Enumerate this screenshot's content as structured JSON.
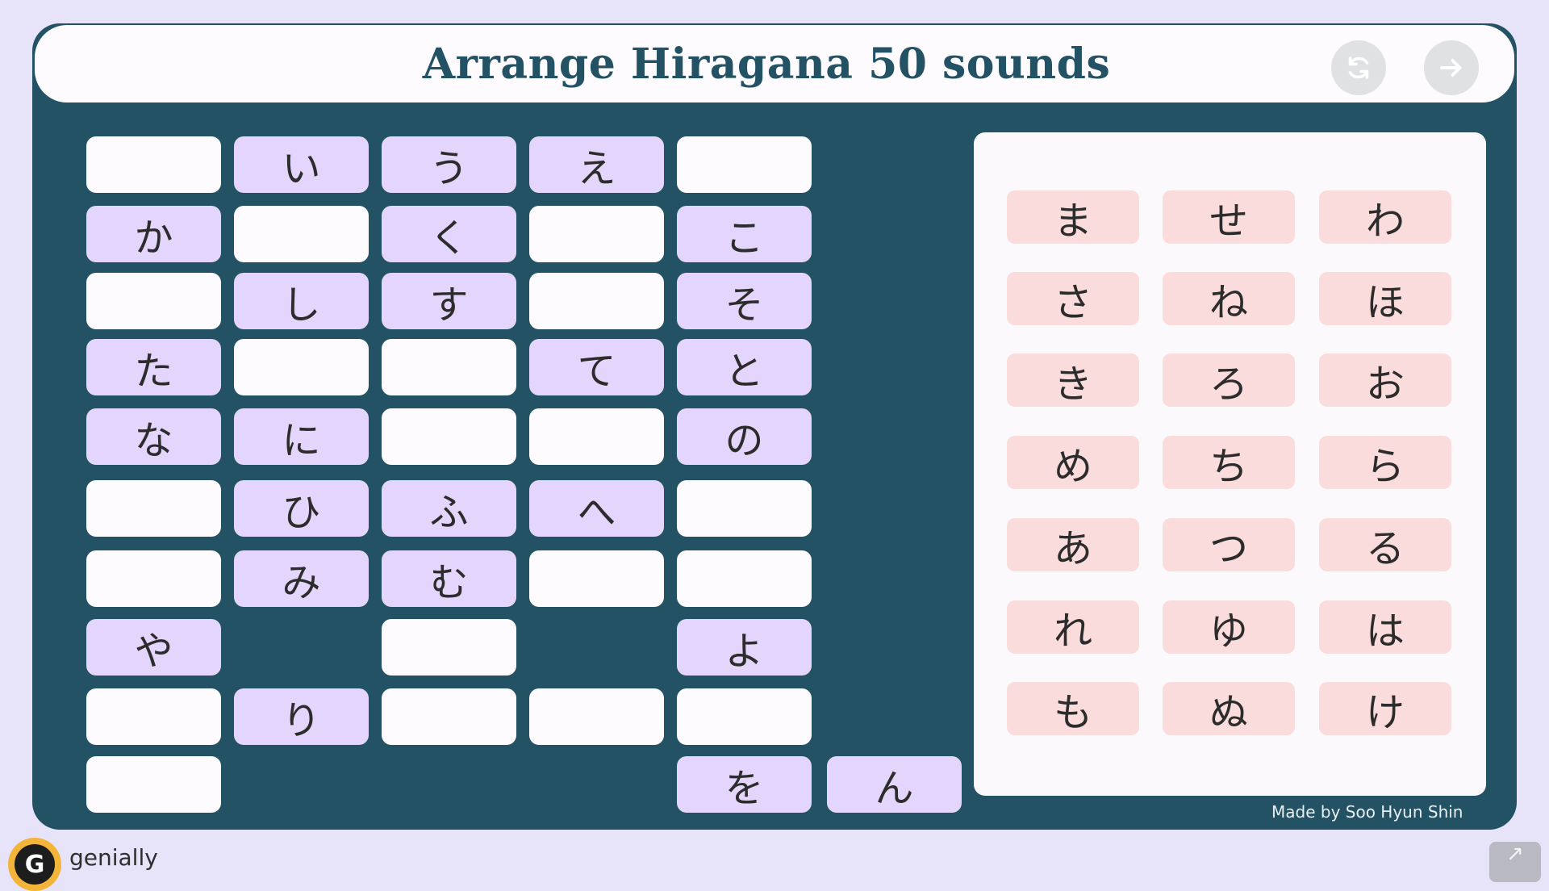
{
  "title": "Arrange Hiragana 50 sounds",
  "header": {
    "reset_icon": "refresh-icon",
    "next_icon": "arrow-right-icon"
  },
  "grid": {
    "slots": [
      {
        "col": 0,
        "row": 0,
        "char": ""
      },
      {
        "col": 1,
        "row": 0,
        "char": "い"
      },
      {
        "col": 2,
        "row": 0,
        "char": "う"
      },
      {
        "col": 3,
        "row": 0,
        "char": "え"
      },
      {
        "col": 4,
        "row": 0,
        "char": ""
      },
      {
        "col": 0,
        "row": 1,
        "char": "か"
      },
      {
        "col": 1,
        "row": 1,
        "char": ""
      },
      {
        "col": 2,
        "row": 1,
        "char": "く"
      },
      {
        "col": 3,
        "row": 1,
        "char": ""
      },
      {
        "col": 4,
        "row": 1,
        "char": "こ"
      },
      {
        "col": 0,
        "row": 2,
        "char": ""
      },
      {
        "col": 1,
        "row": 2,
        "char": "し"
      },
      {
        "col": 2,
        "row": 2,
        "char": "す"
      },
      {
        "col": 3,
        "row": 2,
        "char": ""
      },
      {
        "col": 4,
        "row": 2,
        "char": "そ"
      },
      {
        "col": 0,
        "row": 3,
        "char": "た"
      },
      {
        "col": 1,
        "row": 3,
        "char": ""
      },
      {
        "col": 2,
        "row": 3,
        "char": ""
      },
      {
        "col": 3,
        "row": 3,
        "char": "て"
      },
      {
        "col": 4,
        "row": 3,
        "char": "と"
      },
      {
        "col": 0,
        "row": 4,
        "char": "な"
      },
      {
        "col": 1,
        "row": 4,
        "char": "に"
      },
      {
        "col": 2,
        "row": 4,
        "char": ""
      },
      {
        "col": 3,
        "row": 4,
        "char": ""
      },
      {
        "col": 4,
        "row": 4,
        "char": "の"
      },
      {
        "col": 0,
        "row": 5,
        "char": ""
      },
      {
        "col": 1,
        "row": 5,
        "char": "ひ"
      },
      {
        "col": 2,
        "row": 5,
        "char": "ふ"
      },
      {
        "col": 3,
        "row": 5,
        "char": "へ"
      },
      {
        "col": 4,
        "row": 5,
        "char": ""
      },
      {
        "col": 0,
        "row": 6,
        "char": ""
      },
      {
        "col": 1,
        "row": 6,
        "char": "み"
      },
      {
        "col": 2,
        "row": 6,
        "char": "む"
      },
      {
        "col": 3,
        "row": 6,
        "char": ""
      },
      {
        "col": 4,
        "row": 6,
        "char": ""
      },
      {
        "col": 0,
        "row": 7,
        "char": "や"
      },
      {
        "col": 2,
        "row": 7,
        "char": ""
      },
      {
        "col": 4,
        "row": 7,
        "char": "よ"
      },
      {
        "col": 0,
        "row": 8,
        "char": ""
      },
      {
        "col": 1,
        "row": 8,
        "char": "り"
      },
      {
        "col": 2,
        "row": 8,
        "char": ""
      },
      {
        "col": 3,
        "row": 8,
        "char": ""
      },
      {
        "col": 4,
        "row": 8,
        "char": ""
      },
      {
        "col": 0,
        "row": 9,
        "char": ""
      },
      {
        "col": 4,
        "row": 9,
        "char": "を"
      },
      {
        "col": 5,
        "row": 9,
        "char": "ん"
      }
    ]
  },
  "pool": {
    "tiles": [
      [
        "ま",
        "せ",
        "わ"
      ],
      [
        "さ",
        "ね",
        "ほ"
      ],
      [
        "き",
        "ろ",
        "お"
      ],
      [
        "め",
        "ち",
        "ら"
      ],
      [
        "あ",
        "つ",
        "る"
      ],
      [
        "れ",
        "ゆ",
        "は"
      ],
      [
        "も",
        "ぬ",
        "け"
      ]
    ]
  },
  "credit": "Made by Soo Hyun Shin",
  "footer": {
    "brand": "genially",
    "logo_letter": "G"
  },
  "colors": {
    "board": "#225264",
    "slot_empty": "#fdfbfe",
    "slot_filled": "#e3d5fb",
    "tile": "#fadcdc",
    "background": "#e7e3f8"
  }
}
